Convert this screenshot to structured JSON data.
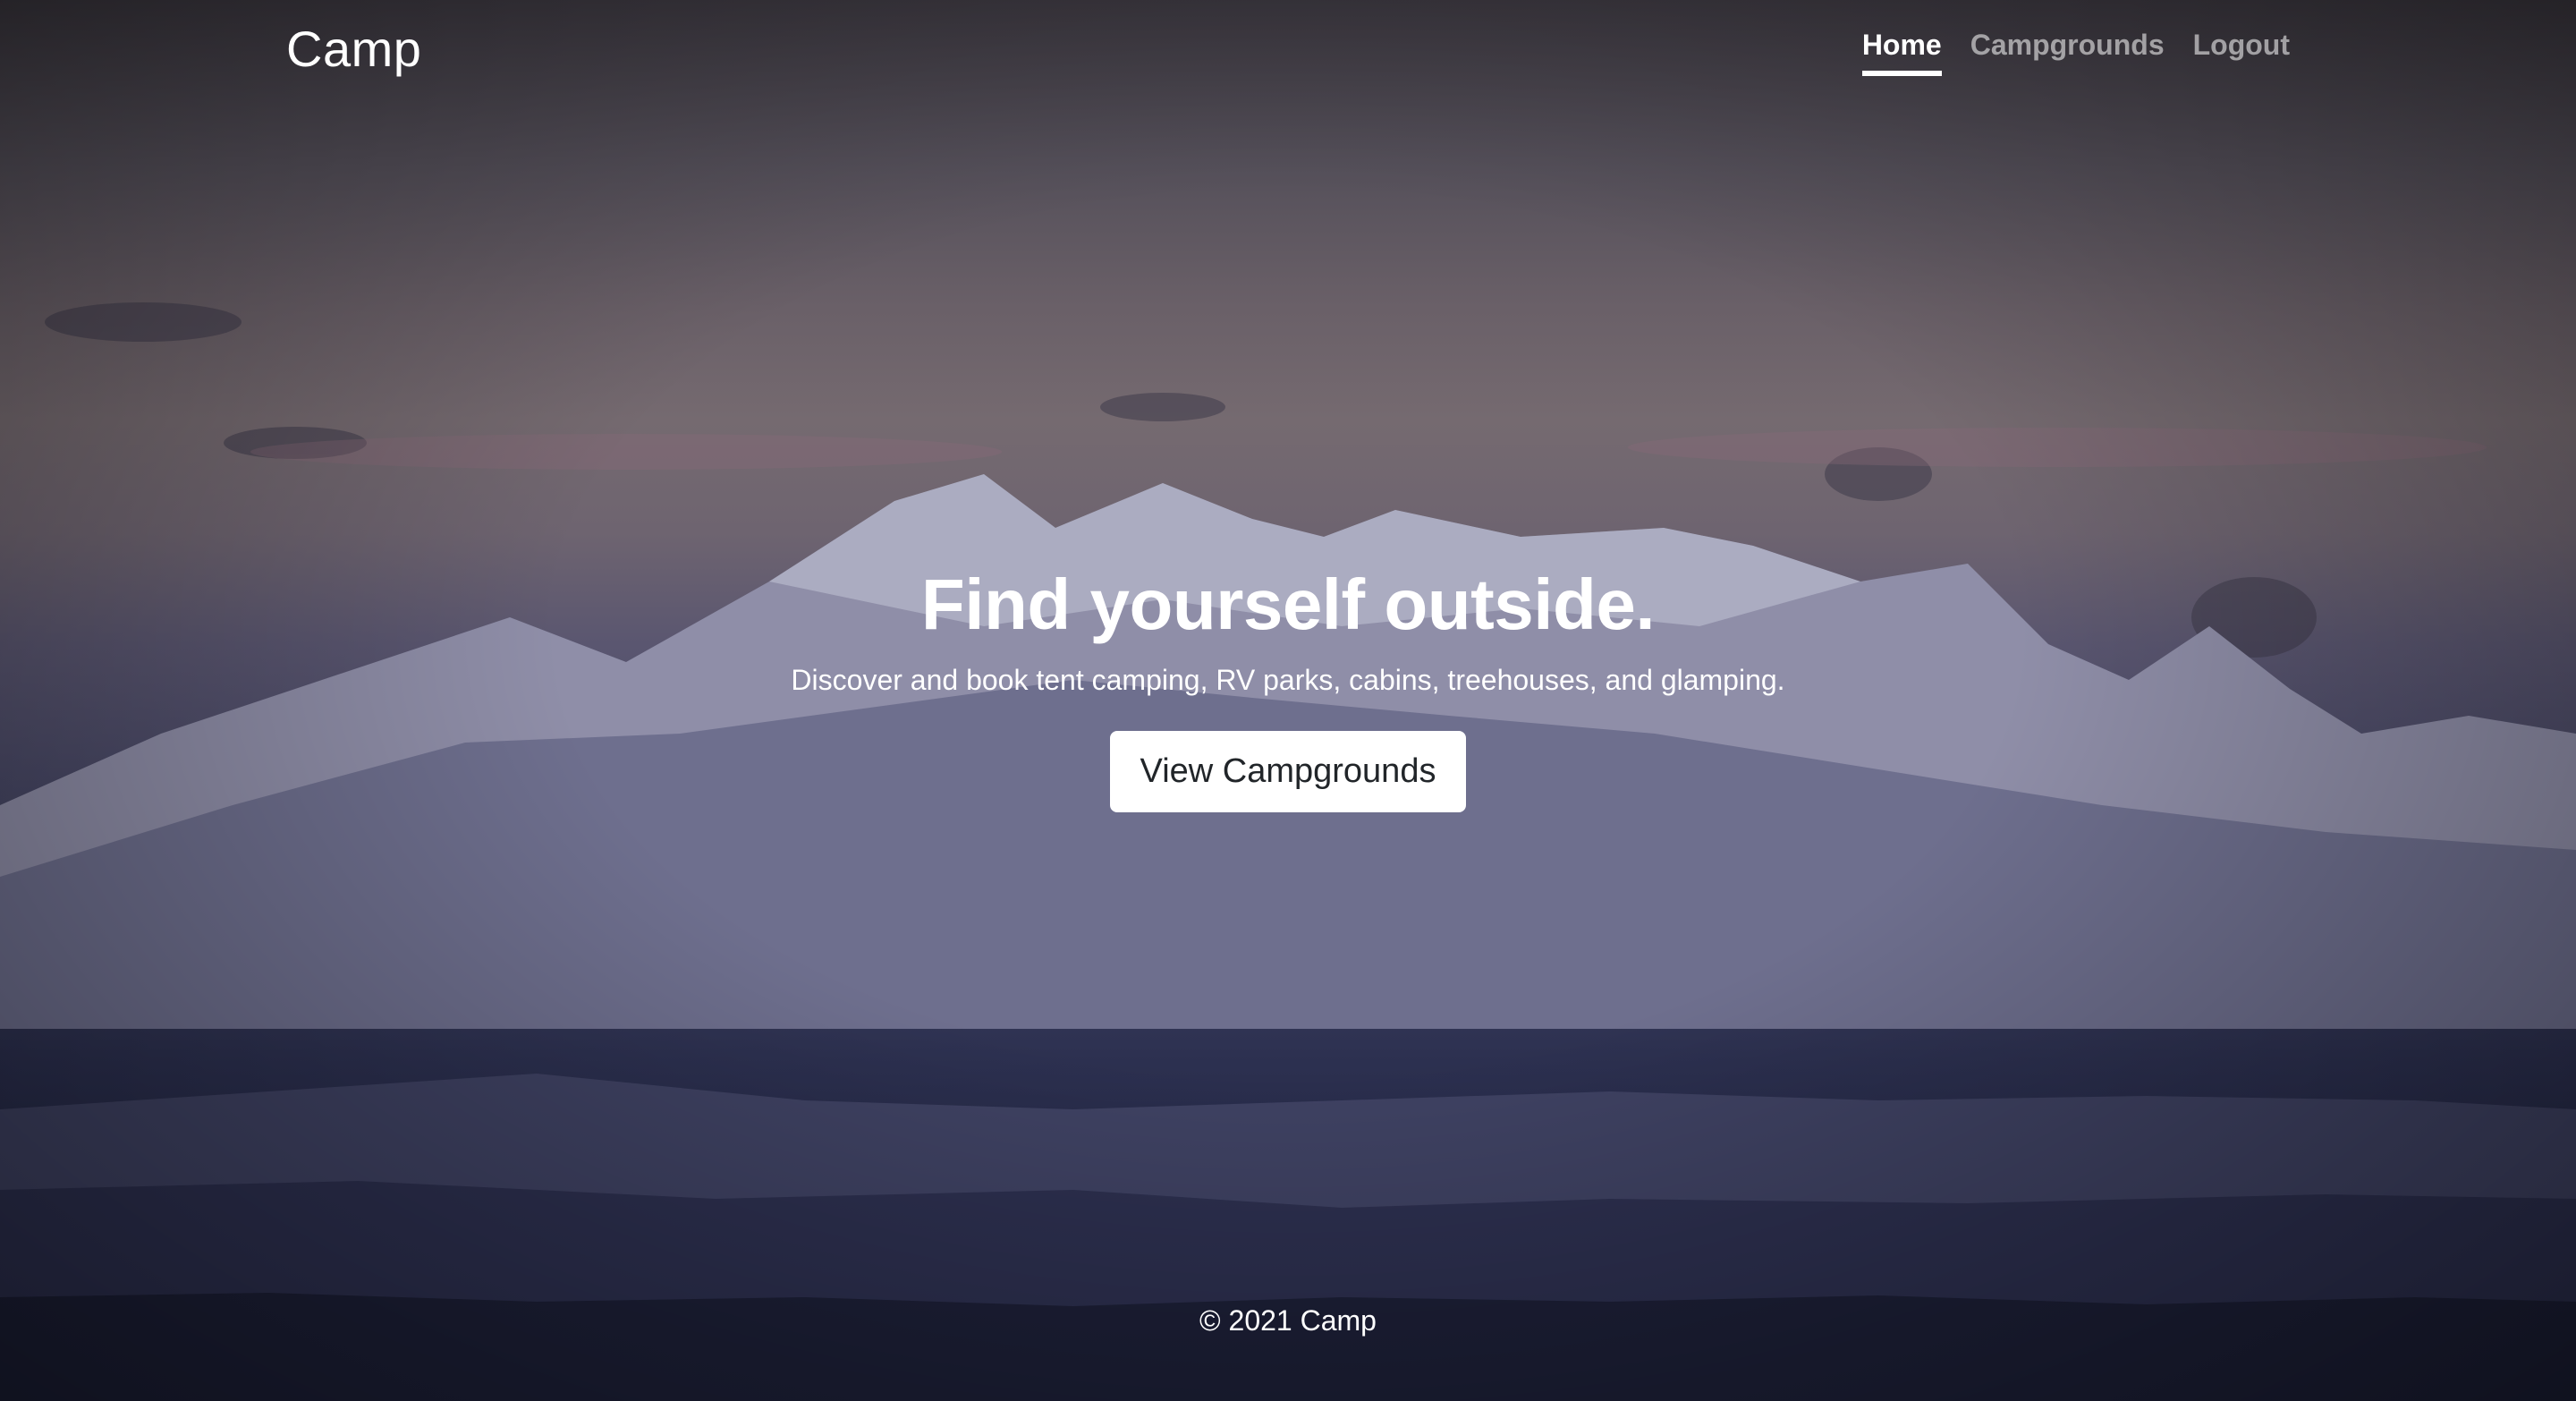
{
  "header": {
    "brand": "Camp",
    "nav": [
      {
        "label": "Home",
        "active": true
      },
      {
        "label": "Campgrounds",
        "active": false
      },
      {
        "label": "Logout",
        "active": false
      }
    ]
  },
  "main": {
    "headline": "Find yourself outside.",
    "subheadline": "Discover and book tent camping, RV parks, cabins, treehouses, and glamping.",
    "cta_label": "View Campgrounds"
  },
  "footer": {
    "copyright": "© 2021 Camp"
  },
  "colors": {
    "text": "#ffffff",
    "button_bg": "#ffffff",
    "button_text": "#212529"
  }
}
